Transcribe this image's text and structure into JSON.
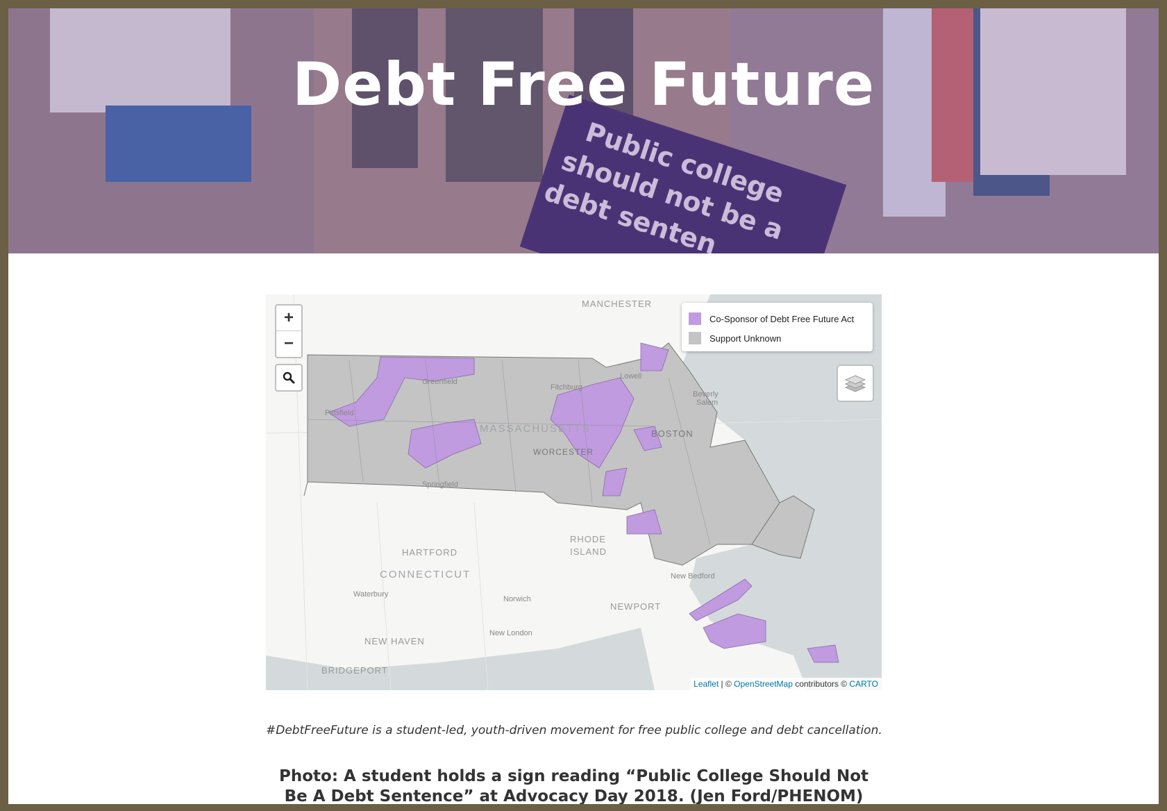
{
  "hero": {
    "title": "Debt Free Future"
  },
  "map": {
    "zoom_in_label": "+",
    "zoom_out_label": "−",
    "legend": [
      {
        "label": "Co-Sponsor of Debt Free Future Act",
        "color": "#c09be0"
      },
      {
        "label": "Support Unknown",
        "color": "#c4c4c4"
      }
    ],
    "labels": {
      "manchester": "MANCHESTER",
      "massachusetts": "MASSACHUSETTS",
      "boston": "BOSTON",
      "worcester": "WORCESTER",
      "springfield": "Springfield",
      "pittsfield": "Pittsfield",
      "greenfield": "Greenfield",
      "fitchburg": "Fitchburg",
      "lowell": "Lowell",
      "salem": "Salem",
      "beverly": "Beverly",
      "rhode_island_1": "RHODE",
      "rhode_island_2": "ISLAND",
      "hartford": "HARTFORD",
      "connecticut": "CONNECTICUT",
      "waterbury": "Waterbury",
      "norwich": "Norwich",
      "newport": "NEWPORT",
      "new_bedford": "New Bedford",
      "new_haven": "NEW HAVEN",
      "new_london": "New London",
      "bridgeport": "BRIDGEPORT"
    },
    "attribution": {
      "leaflet": "Leaflet",
      "sep1": " | © ",
      "osm": "OpenStreetMap",
      "mid": " contributors © ",
      "carto": "CARTO"
    },
    "colors": {
      "sponsor": "#c09be0",
      "unknown": "#c4c4c4",
      "water": "#d4dadc"
    }
  },
  "caption": "#DebtFreeFuture is a student-led, youth-driven movement for free public college and debt cancellation.",
  "photo_caption": "Photo: A student holds a sign reading “Public College Should Not Be A Debt Sentence” at Advocacy Day 2018. (Jen Ford/PHENOM)"
}
